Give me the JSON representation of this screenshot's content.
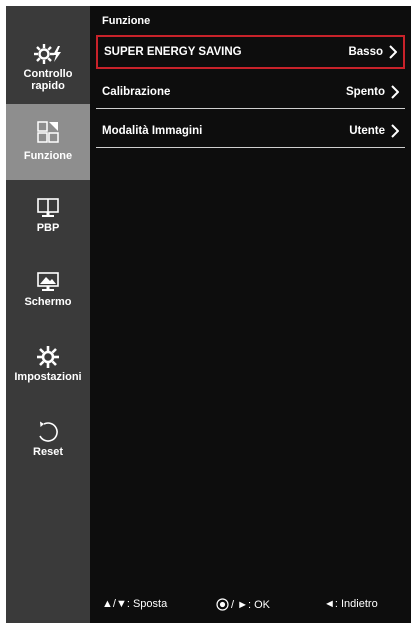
{
  "sidebar": {
    "items": [
      {
        "label_line1": "Controllo",
        "label_line2": "rapido",
        "icon": "quick-settings-icon"
      },
      {
        "label": "Funzione",
        "icon": "function-icon"
      },
      {
        "label": "PBP",
        "icon": "pbp-icon"
      },
      {
        "label": "Schermo",
        "icon": "screen-icon"
      },
      {
        "label": "Impostazioni",
        "icon": "settings-gear-icon"
      },
      {
        "label": "Reset",
        "icon": "reset-icon"
      }
    ],
    "active_index": 1
  },
  "main": {
    "title": "Funzione",
    "rows": [
      {
        "name": "SUPER ENERGY SAVING",
        "value": "Basso"
      },
      {
        "name": "Calibrazione",
        "value": "Spento"
      },
      {
        "name": "Modalità Immagini",
        "value": "Utente"
      }
    ],
    "selected_index": 0
  },
  "footer": {
    "move": "▲/▼: Sposta",
    "ok": "/ ►: OK",
    "back": "◄: Indietro"
  },
  "colors": {
    "highlight_border": "#c8222a",
    "sidebar_bg": "#3a3a3a",
    "active_item_bg": "#8e8e8e",
    "panel_bg": "#0d0d0d"
  }
}
